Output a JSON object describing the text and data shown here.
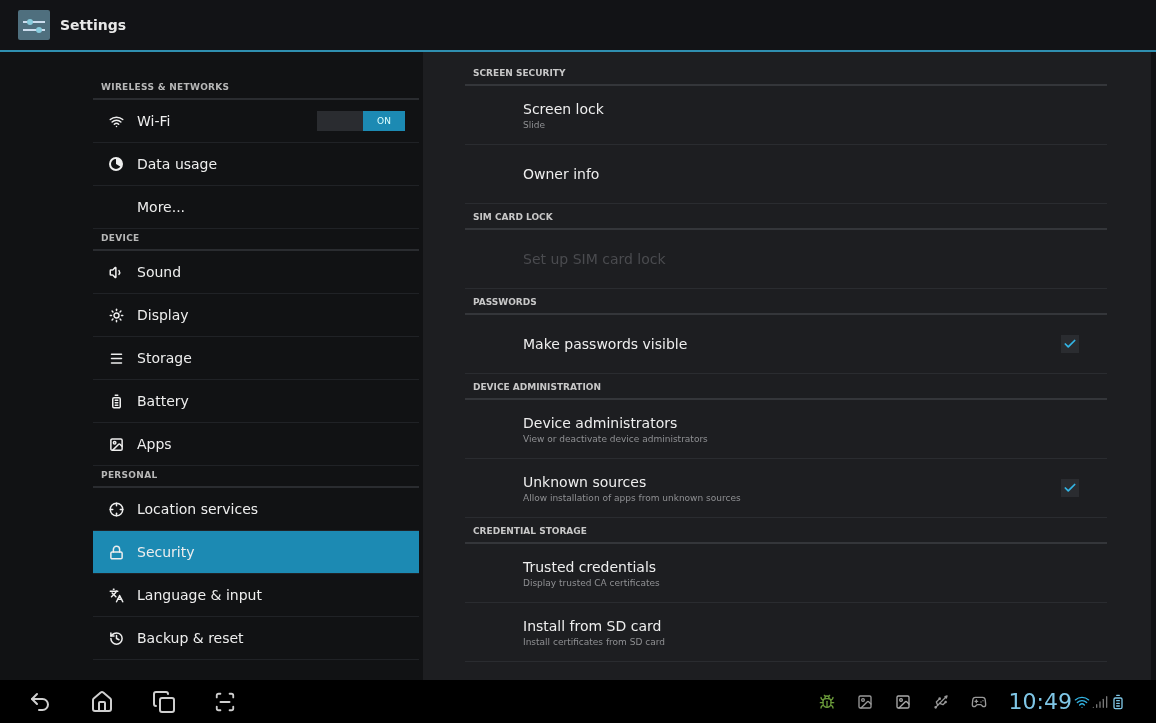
{
  "title_bar": {
    "title": "Settings"
  },
  "sidebar": [
    {
      "kind": "header",
      "label": "WIRELESS & NETWORKS"
    },
    {
      "kind": "item",
      "label": "Wi-Fi",
      "selected": false,
      "toggle": {
        "label": "ON",
        "on": true
      }
    },
    {
      "kind": "item",
      "label": "Data usage",
      "selected": false
    },
    {
      "kind": "item",
      "label": "More...",
      "selected": false
    },
    {
      "kind": "header",
      "label": "DEVICE"
    },
    {
      "kind": "item",
      "label": "Sound",
      "selected": false
    },
    {
      "kind": "item",
      "label": "Display",
      "selected": false
    },
    {
      "kind": "item",
      "label": "Storage",
      "selected": false
    },
    {
      "kind": "item",
      "label": "Battery",
      "selected": false
    },
    {
      "kind": "item",
      "label": "Apps",
      "selected": false
    },
    {
      "kind": "header",
      "label": "PERSONAL"
    },
    {
      "kind": "item",
      "label": "Location services",
      "selected": false
    },
    {
      "kind": "item",
      "label": "Security",
      "selected": true
    },
    {
      "kind": "item",
      "label": "Language & input",
      "selected": false
    },
    {
      "kind": "item",
      "label": "Backup & reset",
      "selected": false
    }
  ],
  "content": [
    {
      "kind": "header",
      "label": "SCREEN SECURITY"
    },
    {
      "kind": "item",
      "title": "Screen lock",
      "summary": "Slide",
      "disabled": false
    },
    {
      "kind": "item",
      "title": "Owner info",
      "disabled": false
    },
    {
      "kind": "header",
      "label": "SIM CARD LOCK"
    },
    {
      "kind": "item",
      "title": "Set up SIM card lock",
      "disabled": true
    },
    {
      "kind": "header",
      "label": "PASSWORDS"
    },
    {
      "kind": "checkbox",
      "title": "Make passwords visible",
      "checked": true,
      "disabled": false
    },
    {
      "kind": "header",
      "label": "DEVICE ADMINISTRATION"
    },
    {
      "kind": "item",
      "title": "Device administrators",
      "summary": "View or deactivate device administrators",
      "disabled": false
    },
    {
      "kind": "checkbox",
      "title": "Unknown sources",
      "summary": "Allow installation of apps from unknown sources",
      "checked": true,
      "disabled": false
    },
    {
      "kind": "header",
      "label": "CREDENTIAL STORAGE"
    },
    {
      "kind": "item",
      "title": "Trusted credentials",
      "summary": "Display trusted CA certificates",
      "disabled": false
    },
    {
      "kind": "item",
      "title": "Install from SD card",
      "summary": "Install certificates from SD card",
      "disabled": false
    }
  ],
  "status_bar": {
    "time": "10:49"
  }
}
